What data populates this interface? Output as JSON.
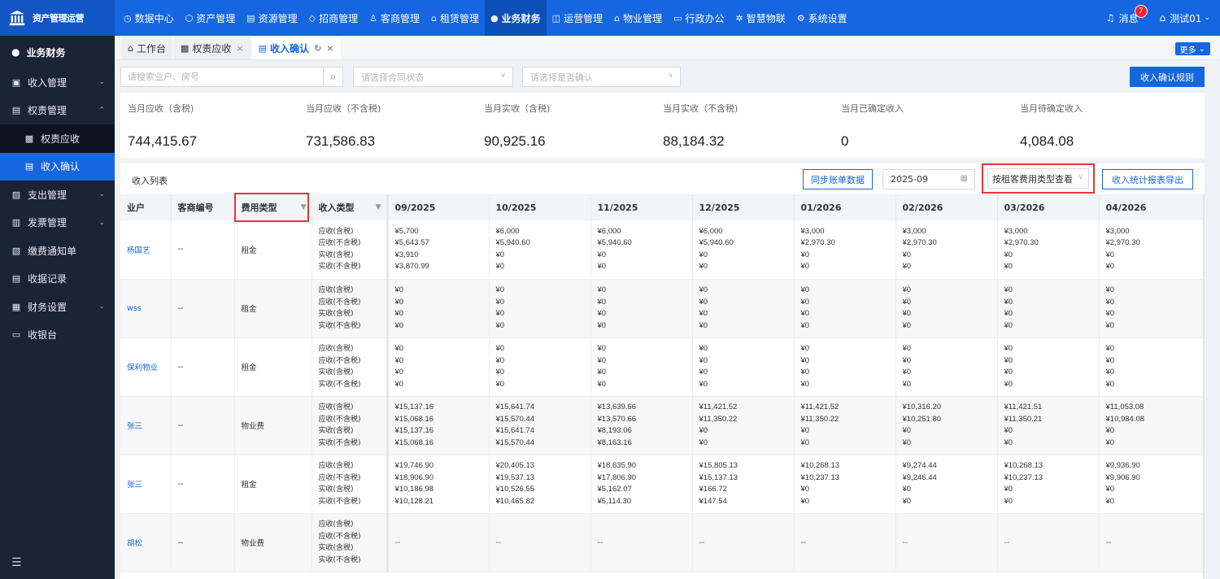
{
  "brand": {
    "name": "资产管理运营",
    "icon": "bank-icon"
  },
  "topnav": [
    {
      "label": "数据中心",
      "icon": "◷"
    },
    {
      "label": "资产管理",
      "icon": "⬡"
    },
    {
      "label": "资源管理",
      "icon": "▤"
    },
    {
      "label": "招商管理",
      "icon": "◇"
    },
    {
      "label": "客商管理",
      "icon": "♙"
    },
    {
      "label": "租赁管理",
      "icon": "⌂"
    },
    {
      "label": "业务财务",
      "icon": "●",
      "active": true
    },
    {
      "label": "运营管理",
      "icon": "◫"
    },
    {
      "label": "物业管理",
      "icon": "⌂"
    },
    {
      "label": "行政办公",
      "icon": "▭"
    },
    {
      "label": "智慧物联",
      "icon": "✲"
    },
    {
      "label": "系统设置",
      "icon": "⚙"
    }
  ],
  "header": {
    "messages": "消息",
    "badge": "7",
    "user": "测试01"
  },
  "sidebar": {
    "title": "业务财务",
    "items": [
      {
        "label": "收入管理",
        "icon": "▣",
        "chevron": "⌄"
      },
      {
        "label": "权责管理",
        "icon": "▤",
        "chevron": "⌃"
      },
      {
        "label": "权责应收",
        "icon": "▩",
        "sub": true
      },
      {
        "label": "收入确认",
        "icon": "▤",
        "sub": true,
        "active": true
      },
      {
        "label": "支出管理",
        "icon": "▨",
        "chevron": "⌄"
      },
      {
        "label": "发票管理",
        "icon": "▥",
        "chevron": "⌄"
      },
      {
        "label": "缴费通知单",
        "icon": "▧"
      },
      {
        "label": "收据记录",
        "icon": "▤"
      },
      {
        "label": "财务设置",
        "icon": "▦",
        "chevron": "⌄"
      },
      {
        "label": "收银台",
        "icon": "▭"
      }
    ]
  },
  "tabs": [
    {
      "label": "工作台",
      "icon": "⌂",
      "closable": false
    },
    {
      "label": "权责应收",
      "icon": "▩",
      "closable": true
    },
    {
      "label": "收入确认",
      "icon": "▤",
      "closable": true,
      "active": true
    }
  ],
  "more_label": "更多",
  "filters": {
    "search_placeholder": "请搜索业户、房号",
    "contract_status_placeholder": "请选择合同状态",
    "confirmed_placeholder": "请选择是否确认",
    "rule_button": "收入确认规则"
  },
  "stats": [
    {
      "label": "当月应收（含税)",
      "value": "744,415.67"
    },
    {
      "label": "当月应收（不含税)",
      "value": "731,586.83"
    },
    {
      "label": "当月实收（含税)",
      "value": "90,925.16"
    },
    {
      "label": "当月实收（不含税)",
      "value": "88,184.32"
    },
    {
      "label": "当月已确定收入",
      "value": "0"
    },
    {
      "label": "当月待确定收入",
      "value": "4,084.08"
    }
  ],
  "list": {
    "title": "收入列表",
    "sync_button": "同步账单数据",
    "month": "2025-09",
    "view_mode": "按租客费用类型查看",
    "export_button": "收入统计报表导出",
    "columns": [
      "业户",
      "客商编号",
      "费用类型",
      "收入类型"
    ],
    "months": [
      "09/2025",
      "10/2025",
      "11/2025",
      "12/2025",
      "01/2026",
      "02/2026",
      "03/2026",
      "04/2026"
    ],
    "income_types": [
      "应收(含税)",
      "应收(不含税)",
      "实收(含税)",
      "实收(不含税)"
    ],
    "rows": [
      {
        "owner": "杨国艺",
        "code": "--",
        "fee": "租金",
        "values": [
          [
            "¥5,700",
            "¥5,643.57",
            "¥3,910",
            "¥3,870.99"
          ],
          [
            "¥6,000",
            "¥5,940.60",
            "¥0",
            "¥0"
          ],
          [
            "¥6,000",
            "¥5,940.60",
            "¥0",
            "¥0"
          ],
          [
            "¥6,000",
            "¥5,940.60",
            "¥0",
            "¥0"
          ],
          [
            "¥3,000",
            "¥2,970.30",
            "¥0",
            "¥0"
          ],
          [
            "¥3,000",
            "¥2,970.30",
            "¥0",
            "¥0"
          ],
          [
            "¥3,000",
            "¥2,970.30",
            "¥0",
            "¥0"
          ],
          [
            "¥3,000",
            "¥2,970.30",
            "¥0",
            "¥0"
          ]
        ]
      },
      {
        "owner": "wss",
        "code": "--",
        "fee": "租金",
        "values": [
          [
            "¥0",
            "¥0",
            "¥0",
            "¥0"
          ],
          [
            "¥0",
            "¥0",
            "¥0",
            "¥0"
          ],
          [
            "¥0",
            "¥0",
            "¥0",
            "¥0"
          ],
          [
            "¥0",
            "¥0",
            "¥0",
            "¥0"
          ],
          [
            "¥0",
            "¥0",
            "¥0",
            "¥0"
          ],
          [
            "¥0",
            "¥0",
            "¥0",
            "¥0"
          ],
          [
            "¥0",
            "¥0",
            "¥0",
            "¥0"
          ],
          [
            "¥0",
            "¥0",
            "¥0",
            "¥0"
          ]
        ]
      },
      {
        "owner": "保利物业",
        "code": "--",
        "fee": "租金",
        "values": [
          [
            "¥0",
            "¥0",
            "¥0",
            "¥0"
          ],
          [
            "¥0",
            "¥0",
            "¥0",
            "¥0"
          ],
          [
            "¥0",
            "¥0",
            "¥0",
            "¥0"
          ],
          [
            "¥0",
            "¥0",
            "¥0",
            "¥0"
          ],
          [
            "¥0",
            "¥0",
            "¥0",
            "¥0"
          ],
          [
            "¥0",
            "¥0",
            "¥0",
            "¥0"
          ],
          [
            "¥0",
            "¥0",
            "¥0",
            "¥0"
          ],
          [
            "¥0",
            "¥0",
            "¥0",
            "¥0"
          ]
        ]
      },
      {
        "owner": "张三",
        "code": "--",
        "fee": "物业费",
        "values": [
          [
            "¥15,137.16",
            "¥15,068.16",
            "¥15,137.16",
            "¥15,068.16"
          ],
          [
            "¥15,641.74",
            "¥15,570.44",
            "¥15,641.74",
            "¥15,570.44"
          ],
          [
            "¥13,639.66",
            "¥13,570.66",
            "¥8,193.06",
            "¥8,163.16"
          ],
          [
            "¥11,421.52",
            "¥11,350.22",
            "¥0",
            "¥0"
          ],
          [
            "¥11,421.52",
            "¥11,350.22",
            "¥0",
            "¥0"
          ],
          [
            "¥10,316.20",
            "¥10,251.80",
            "¥0",
            "¥0"
          ],
          [
            "¥11,421.51",
            "¥11,350.21",
            "¥0",
            "¥0"
          ],
          [
            "¥11,053.08",
            "¥10,984.08",
            "¥0",
            "¥0"
          ]
        ]
      },
      {
        "owner": "张三",
        "code": "--",
        "fee": "租金",
        "values": [
          [
            "¥19,746.90",
            "¥18,906.90",
            "¥10,186.98",
            "¥10,128.21"
          ],
          [
            "¥20,405.13",
            "¥19,537.13",
            "¥10,526.55",
            "¥10,465.82"
          ],
          [
            "¥18,635.90",
            "¥17,806.90",
            "¥5,162.07",
            "¥5,114.30"
          ],
          [
            "¥15,805.13",
            "¥15,137.13",
            "¥166.72",
            "¥147.54"
          ],
          [
            "¥10,268.13",
            "¥10,237.13",
            "¥0",
            "¥0"
          ],
          [
            "¥9,274.44",
            "¥9,246.44",
            "¥0",
            "¥0"
          ],
          [
            "¥10,268.13",
            "¥10,237.13",
            "¥0",
            "¥0"
          ],
          [
            "¥9,936.90",
            "¥9,906.90",
            "¥0",
            "¥0"
          ]
        ]
      },
      {
        "owner": "胡松",
        "code": "--",
        "fee": "物业费",
        "empty": "--",
        "values": null
      }
    ]
  }
}
